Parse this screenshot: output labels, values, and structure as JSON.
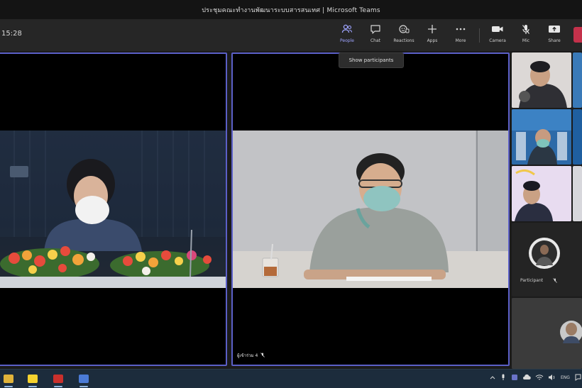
{
  "window": {
    "title": "ประชุมคณะทำงานพัฒนาระบบสารสนเทศ | Microsoft Teams"
  },
  "toolbar": {
    "timer": "15:28",
    "buttons": [
      {
        "id": "people",
        "label": "People",
        "icon": "people-icon",
        "active": true
      },
      {
        "id": "chat",
        "label": "Chat",
        "icon": "chat-icon"
      },
      {
        "id": "reactions",
        "label": "Reactions",
        "icon": "reactions-icon"
      },
      {
        "id": "apps",
        "label": "Apps",
        "icon": "add-icon"
      },
      {
        "id": "more",
        "label": "More",
        "icon": "more-icon"
      },
      {
        "id": "camera",
        "label": "Camera",
        "icon": "camera-icon"
      },
      {
        "id": "mic",
        "label": "Mic",
        "icon": "mic-icon"
      },
      {
        "id": "share",
        "label": "Share",
        "icon": "share-icon"
      }
    ],
    "leave_color": "#c4314b",
    "accent": "#5b5fc7"
  },
  "tooltip": {
    "text": "Show participants"
  },
  "tiles": {
    "right_name": "ผู้เข้าร่วม 4"
  },
  "strip": {
    "avatar_name": "Participant"
  },
  "taskbar": {
    "apps": [
      {
        "name": "file-explorer",
        "color": "#e0b33a"
      },
      {
        "name": "sticky-notes",
        "color": "#f5d22f"
      },
      {
        "name": "acrobat-reader",
        "color": "#c9302c"
      },
      {
        "name": "teams-app",
        "color": "#4b7bd6"
      }
    ],
    "lang": "ENG"
  }
}
